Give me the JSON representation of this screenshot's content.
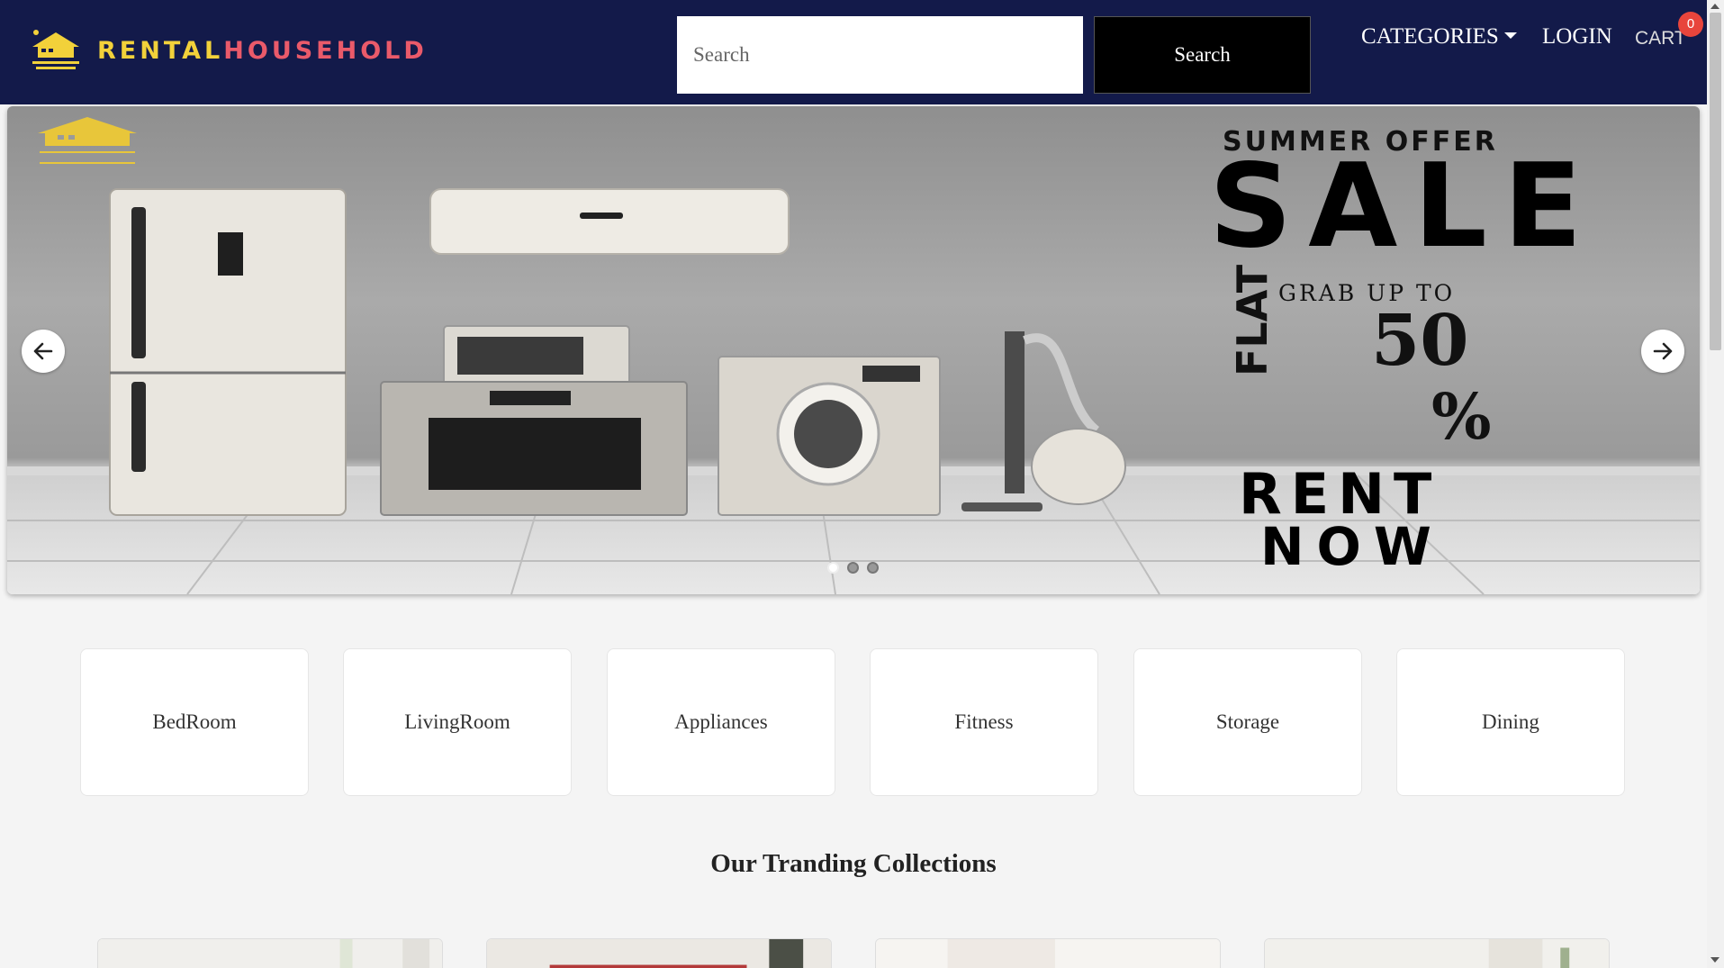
{
  "navbar": {
    "brand_part1": "RENTAL",
    "brand_part2": "HOUSEHOLD",
    "search_placeholder": "Search",
    "search_button": "Search",
    "categories_label": "CATEGORIES",
    "login_label": "LOGIN",
    "cart_label": "CART",
    "cart_count": "0"
  },
  "carousel": {
    "offer_subtitle": "SUMMER OFFER",
    "offer_title": "SALE",
    "offer_grab": "GRAB UP TO",
    "offer_flat": "FLAT",
    "offer_percent": "50",
    "offer_percent_sign": "%",
    "offer_rent": "RENT",
    "offer_now": "NOW",
    "active_slide": 1,
    "slide_count": 3
  },
  "categories": [
    "BedRoom",
    "LivingRoom",
    "Appliances",
    "Fitness",
    "Storage",
    "Dining"
  ],
  "collections": {
    "title": "Our Tranding Collections"
  },
  "colors": {
    "navbar_bg": "#131a4a",
    "brand_yellow": "#f2d13a",
    "brand_pink": "#ea5a6a",
    "cart_badge": "#e8453c"
  },
  "icons": {
    "prev": "arrow-left-icon",
    "next": "arrow-right-icon",
    "caret": "caret-down-icon"
  }
}
